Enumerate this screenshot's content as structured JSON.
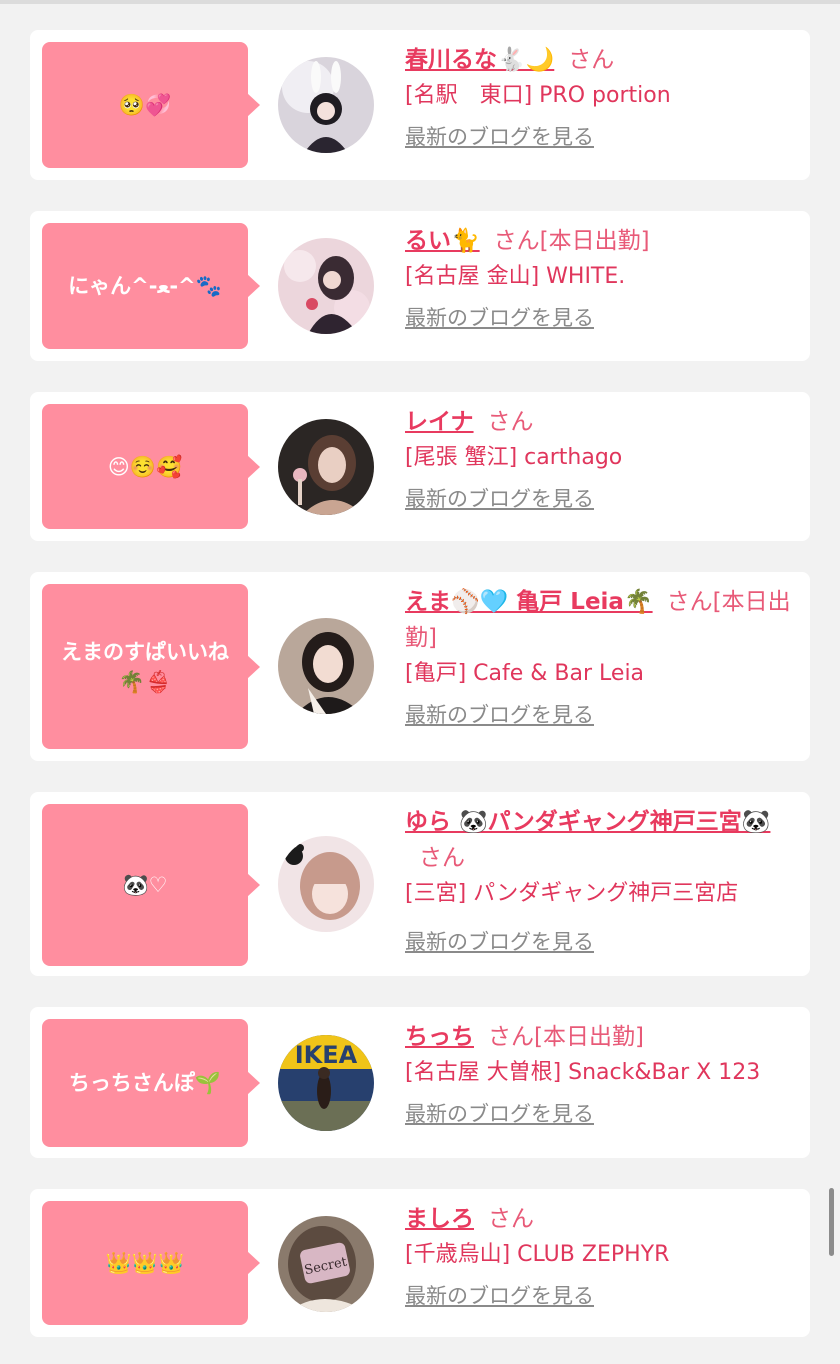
{
  "cards": [
    {
      "bubble": "🥺💞",
      "name": "春川るな🐇🌙",
      "suffix": "さん",
      "shop": "[名駅　東口] PRO portion",
      "blog": "最新のブログを見る"
    },
    {
      "bubble": "にゃん^-ﻌ-^🐾",
      "name": "るい🐈",
      "suffix": "さん[本日出勤]",
      "shop": "[名古屋 金山] WHITE.",
      "blog": "最新のブログを見る"
    },
    {
      "bubble": "😊☺️🥰",
      "name": "レイナ",
      "suffix": "さん",
      "shop": "[尾張 蟹江] carthago",
      "blog": "最新のブログを見る"
    },
    {
      "bubble": "えまのすぱいいね🌴👙",
      "name": "えま⚾️🩵 亀戸 Leia🌴",
      "suffix": "さん[本日出勤]",
      "shop": "[亀戸] Cafe & Bar Leia",
      "blog": "最新のブログを見る"
    },
    {
      "bubble": "🐼♡",
      "name": "ゆら 🐼パンダギャング神戸三宮🐼",
      "suffix": "さん",
      "shop": "[三宮] パンダギャング神戸三宮店",
      "blog": "最新のブログを見る"
    },
    {
      "bubble": "ちっちさんぽ🌱",
      "name": "ちっち",
      "suffix": "さん[本日出勤]",
      "shop": "[名古屋 大曽根] Snack&Bar X 123",
      "blog": "最新のブログを見る"
    },
    {
      "bubble": "👑👑👑",
      "name": "ましろ",
      "suffix": "さん",
      "shop": "[千歳烏山] CLUB ZEPHYR",
      "blog": "最新のブログを見る"
    }
  ],
  "colors": {
    "bubble": "#ff8e9f",
    "name": "#e83a5f",
    "link": "#8a8a8a",
    "background": "#f2f2f2"
  }
}
